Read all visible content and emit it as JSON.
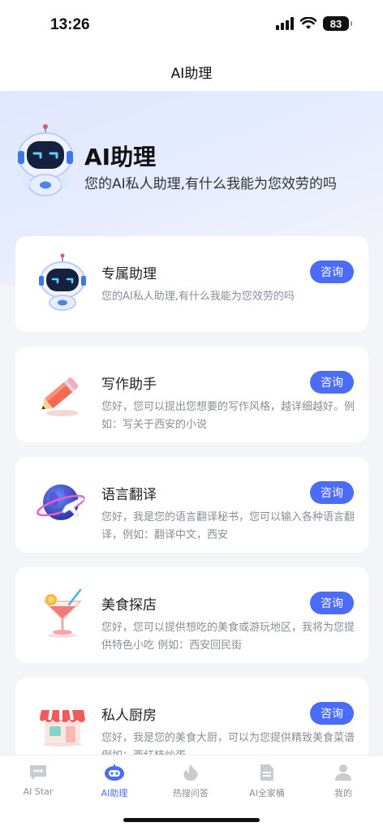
{
  "status_bar": {
    "time": "13:26",
    "battery": "83"
  },
  "nav": {
    "title": "AI助理"
  },
  "hero": {
    "title": "AI助理",
    "subtitle": "您的AI私人助理,有什么我能为您效劳的吗"
  },
  "cards": [
    {
      "title": "专属助理",
      "desc": "您的AI私人助理,有什么我能为您效劳的吗",
      "button": "咨询",
      "icon": "robot-icon"
    },
    {
      "title": "写作助手",
      "desc": "您好，您可以提出您想要的写作风格，越详细越好。例如：写关于西安的小说",
      "button": "咨询",
      "icon": "pencil-icon"
    },
    {
      "title": "语言翻译",
      "desc": "您好，我是您的语言翻译秘书，您可以输入各种语言翻译，例如：翻译中文，西安",
      "button": "咨询",
      "icon": "globe-plane-icon"
    },
    {
      "title": "美食探店",
      "desc": "您好，您可以提供想吃的美食或游玩地区，我将为您提供特色小吃 例如：西安回民街",
      "button": "咨询",
      "icon": "cocktail-icon"
    },
    {
      "title": "私人厨房",
      "desc": "您好，我是您的美食大厨，可以为您提供精致美食菜谱 例如：西红柿炒蛋",
      "button": "咨询",
      "icon": "shop-icon"
    }
  ],
  "tabs": [
    {
      "label": "AI Star",
      "icon": "chat-icon",
      "active": false
    },
    {
      "label": "AI助理",
      "icon": "robot-icon",
      "active": true
    },
    {
      "label": "热搜问答",
      "icon": "flame-icon",
      "active": false
    },
    {
      "label": "AI全家桶",
      "icon": "document-icon",
      "active": false
    },
    {
      "label": "我的",
      "icon": "person-icon",
      "active": false
    }
  ],
  "colors": {
    "accent": "#4a6cf7",
    "muted": "#8d8f96"
  }
}
